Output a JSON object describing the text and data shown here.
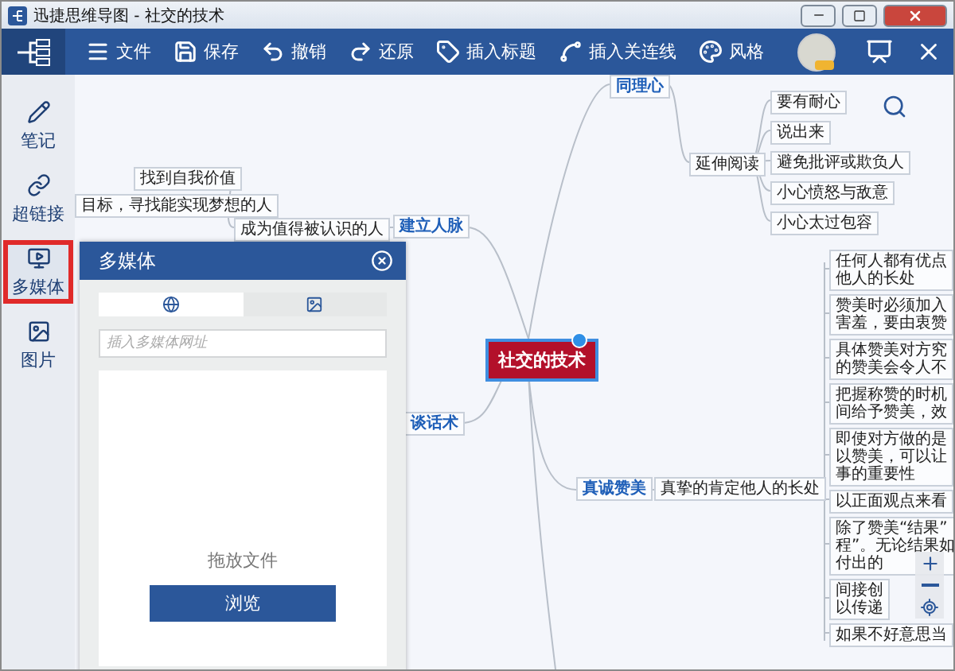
{
  "window": {
    "title": "迅捷思维导图 - 社交的技术"
  },
  "toolbar": {
    "items": [
      {
        "label": "文件",
        "kind": "menu"
      },
      {
        "label": "保存",
        "kind": "save"
      },
      {
        "label": "撤销",
        "kind": "undo"
      },
      {
        "label": "还原",
        "kind": "redo"
      },
      {
        "label": "插入标题",
        "kind": "topic"
      },
      {
        "label": "插入关连线",
        "kind": "relation"
      },
      {
        "label": "风格",
        "kind": "style"
      }
    ]
  },
  "sidebar": {
    "items": [
      {
        "label": "笔记",
        "kind": "note",
        "selected": false
      },
      {
        "label": "超链接",
        "kind": "link",
        "selected": false
      },
      {
        "label": "多媒体",
        "kind": "media",
        "selected": true
      },
      {
        "label": "图片",
        "kind": "image",
        "selected": false
      }
    ]
  },
  "mindmap": {
    "root": "社交的技术",
    "nodes": [
      {
        "text": "同理心",
        "kind": "branch"
      },
      {
        "text": "延伸阅读",
        "kind": "leaf"
      },
      {
        "text": "要有耐心",
        "kind": "leaf"
      },
      {
        "text": "说出来",
        "kind": "leaf"
      },
      {
        "text": "避免批评或欺负人",
        "kind": "leaf"
      },
      {
        "text": "小心愤怒与敌意",
        "kind": "leaf"
      },
      {
        "text": "小心太过包容",
        "kind": "leaf"
      },
      {
        "text": "找到自我价值",
        "kind": "leaf"
      },
      {
        "text": "目标，寻找能实现梦想的人",
        "kind": "leaf"
      },
      {
        "text": "成为值得被认识的人",
        "kind": "leaf"
      },
      {
        "text": "建立人脉",
        "kind": "branch"
      },
      {
        "text": "谈话术",
        "kind": "branch"
      },
      {
        "text": "真诚赞美",
        "kind": "branch"
      },
      {
        "text": "真挚的肯定他人的长处",
        "kind": "leaf"
      },
      {
        "lines": [
          "任何人都有优点",
          "他人的长处"
        ],
        "kind": "leaf"
      },
      {
        "lines": [
          "赞美时必须加入",
          "害羞，要由衷赞"
        ],
        "kind": "leaf"
      },
      {
        "lines": [
          "具体赞美对方究",
          "的赞美会令人不"
        ],
        "kind": "leaf"
      },
      {
        "lines": [
          "把握称赞的时机",
          "间给予赞美，效"
        ],
        "kind": "leaf"
      },
      {
        "lines": [
          "即使对方做的是",
          "以赞美，可以让",
          "事的重要性"
        ],
        "kind": "leaf"
      },
      {
        "text": "以正面观点来看",
        "kind": "leaf"
      },
      {
        "lines": [
          "除了赞美“结果”",
          "程”。无论结果如",
          "付出的"
        ],
        "kind": "leaf"
      },
      {
        "lines": [
          "间接创",
          "以传递"
        ],
        "kind": "leaf"
      },
      {
        "text": "如果不好意思当",
        "kind": "leaf"
      }
    ]
  },
  "multimedia_panel": {
    "title": "多媒体",
    "tabs": [
      {
        "kind": "web",
        "selected": true
      },
      {
        "kind": "image",
        "selected": false
      }
    ],
    "url_field": {
      "placeholder": "插入多媒体网址"
    },
    "drop_text": "拖放文件",
    "browse_button": "浏览"
  }
}
